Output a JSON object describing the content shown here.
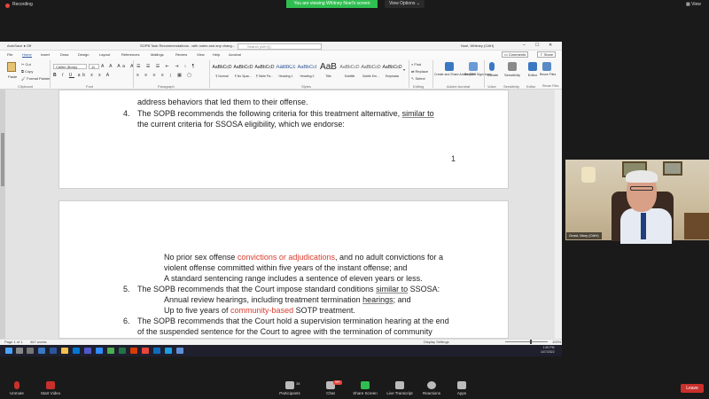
{
  "zoom_top": {
    "recording_label": "Recording",
    "share_banner": "You are viewing Whitney Noel's screen",
    "view_options": "View Options",
    "view_right": "View"
  },
  "word": {
    "autosave": "AutoSave ● Off",
    "title": "SOPB Task Recommendations - with notes and any chang...",
    "search_placeholder": "Search (Alt+Q)",
    "user": "Noel, Whitney (OAH)",
    "tabs": [
      "File",
      "Home",
      "Insert",
      "Draw",
      "Design",
      "Layout",
      "References",
      "Mailings",
      "Review",
      "View",
      "Help",
      "Acrobat"
    ],
    "active_tab": "Home",
    "comments": "Comments",
    "share": "Share",
    "font_name": "Calibri (Body)",
    "font_size": "11",
    "paste": "Paste",
    "cut": "Cut",
    "copy": "Copy",
    "format_painter": "Format Painter",
    "groups": [
      "Clipboard",
      "Font",
      "Paragraph",
      "Styles",
      "Editing",
      "Adobe Acrobat",
      "Voice",
      "Sensitivity",
      "Editor",
      "Reuse Files"
    ],
    "styles": [
      {
        "sample": "AaBbCcD",
        "name": "¶ Normal"
      },
      {
        "sample": "AaBbCcD",
        "name": "¶ No Spac..."
      },
      {
        "sample": "AaBbCcD",
        "name": "¶ Table Pa..."
      },
      {
        "sample": "AaBbCc",
        "name": "Heading 1"
      },
      {
        "sample": "AaBbCcI",
        "name": "Heading 2"
      },
      {
        "sample": "AaB",
        "name": "Title"
      },
      {
        "sample": "AaBbCcD",
        "name": "Subtitle"
      },
      {
        "sample": "AaBbCcD",
        "name": "Subtle Em..."
      },
      {
        "sample": "AaBbCcD",
        "name": "Emphasis"
      }
    ],
    "find": "Find",
    "replace": "Replace",
    "select": "Select",
    "create_share": "Create and Share Adobe PDF",
    "request_signatures": "Request Signatures",
    "dictate": "Dictate",
    "sensitivity": "Sensitivity",
    "editor": "Editor",
    "reuse_files": "Reuse Files"
  },
  "document": {
    "page1_lines": [
      {
        "text": "address behaviors that led them to their offense."
      },
      {
        "num": "4.",
        "text_a": "The SOPB recommends the following criteria for this treatment alternative, ",
        "text_ul": "similar to"
      },
      {
        "text": "the current criteria for SSOSA eligibility, which we endorse:"
      }
    ],
    "page_number": "1",
    "page2_lines": [
      {
        "a": "No prior sex offense ",
        "red": "convictions or adjudications",
        "b": ", and no adult convictions for a"
      },
      {
        "text": "violent offense committed within five years of the instant offense; and"
      },
      {
        "text": "A standard sentencing range includes a sentence of eleven years or less."
      },
      {
        "num": "5.",
        "a": "The SOPB recommends that the Court impose standard conditions ",
        "ul": "similar to",
        "b": " SSOSA:"
      },
      {
        "a": "Annual review hearings, including treatment termination ",
        "ul": "hearings",
        "b": "; and"
      },
      {
        "a": "Up to five years of ",
        "red": "community-based",
        "b": " SOTP treatment."
      },
      {
        "num": "6.",
        "text": "The SOPB recommends that the Court hold a supervision termination hearing at the end"
      },
      {
        "text": "of the suspended sentence for the Court to agree with the termination of community"
      }
    ]
  },
  "status": {
    "page": "Page 1 of 1",
    "words": "467 words",
    "focus": "Display Settings",
    "zoom": "100%"
  },
  "taskbar": {
    "time": "1:50 PM",
    "date": "10/7/2022"
  },
  "video": {
    "participant_name": "Grant, Mary (OAH)"
  },
  "zoom_bottom": {
    "buttons": [
      "Unmute",
      "Start Video",
      "Participants",
      "Chat",
      "Share Screen",
      "Live Transcript",
      "Reactions",
      "Apps"
    ],
    "participants_count": "38",
    "chat_badge": "99+",
    "leave": "Leave"
  },
  "colors": {
    "share_banner": "#2fbf50",
    "word_accent": "#2b579a",
    "leave": "#c9302c",
    "red_text": "#d83b2e"
  }
}
